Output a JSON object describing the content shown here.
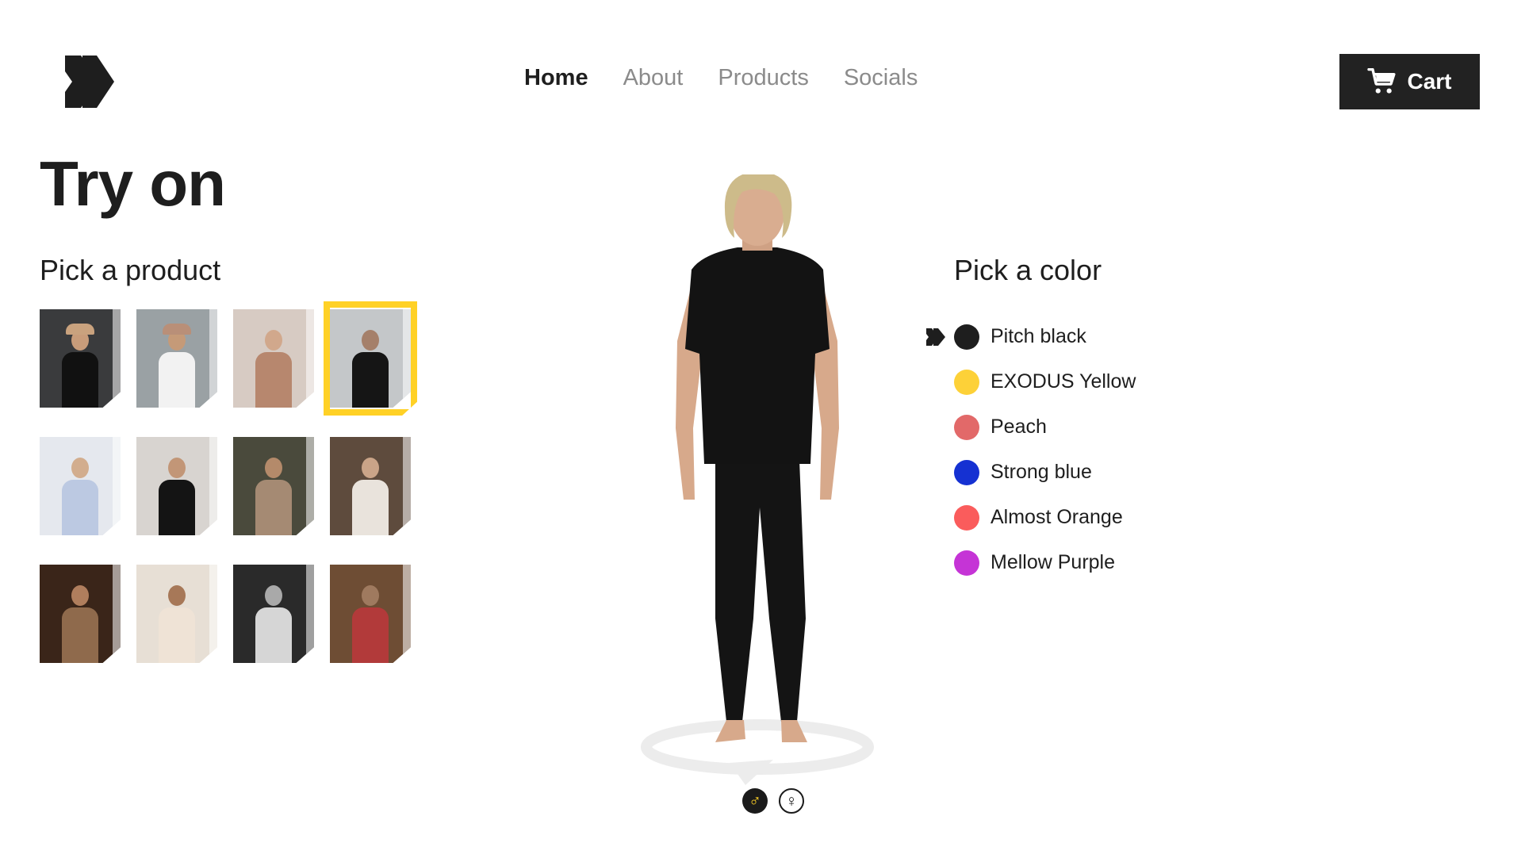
{
  "header": {
    "logo_icon": "double-chevron-logo",
    "nav": [
      {
        "label": "Home",
        "active": true
      },
      {
        "label": "About",
        "active": false
      },
      {
        "label": "Products",
        "active": false
      },
      {
        "label": "Socials",
        "active": false
      }
    ],
    "cart": {
      "label": "Cart",
      "icon": "cart-icon"
    }
  },
  "page": {
    "title": "Try on",
    "pick_product": "Pick a product",
    "pick_color": "Pick a color"
  },
  "products": {
    "selected_index": 3,
    "items": [
      {
        "icon": "product-photo",
        "bg": "#3a3b3d",
        "skin": "#c89c7a",
        "cloth": "#111111",
        "hat": "#c9a27e"
      },
      {
        "icon": "product-photo",
        "bg": "#9aa1a4",
        "skin": "#c59a78",
        "cloth": "#f2f2f2",
        "hat": "#b98f78"
      },
      {
        "icon": "product-photo",
        "bg": "#d7cbc3",
        "skin": "#d1a88c",
        "cloth": "#b7876e",
        "hat": ""
      },
      {
        "icon": "product-photo",
        "bg": "#c4c7c9",
        "skin": "#a5806a",
        "cloth": "#151515",
        "hat": ""
      },
      {
        "icon": "product-photo",
        "bg": "#e5e8ee",
        "skin": "#d2ad8e",
        "cloth": "#bcc9e2",
        "hat": ""
      },
      {
        "icon": "product-photo",
        "bg": "#d8d4d0",
        "skin": "#c29677",
        "cloth": "#141414",
        "hat": ""
      },
      {
        "icon": "product-photo",
        "bg": "#4a4a3c",
        "skin": "#b48a6a",
        "cloth": "#a58a73",
        "hat": ""
      },
      {
        "icon": "product-photo",
        "bg": "#5e4b3d",
        "skin": "#caa488",
        "cloth": "#e9e3dc",
        "hat": ""
      },
      {
        "icon": "product-photo",
        "bg": "#3a2519",
        "skin": "#b07e5d",
        "cloth": "#8f6a4c",
        "hat": ""
      },
      {
        "icon": "product-photo",
        "bg": "#e7dfd5",
        "skin": "#a77858",
        "cloth": "#efe3d6",
        "hat": ""
      },
      {
        "icon": "product-photo",
        "bg": "#2a2a2a",
        "skin": "#a9a9a9",
        "cloth": "#d6d6d6",
        "hat": ""
      },
      {
        "icon": "product-photo",
        "bg": "#6e4d34",
        "skin": "#9f7a5f",
        "cloth": "#b23a3a",
        "hat": ""
      }
    ]
  },
  "avatar": {
    "icon": "3d-avatar",
    "rotate_icon": "rotate-arrow-icon",
    "genders": [
      {
        "icon": "male-icon",
        "symbol": "♂",
        "active": true
      },
      {
        "icon": "female-icon",
        "symbol": "♀",
        "active": false
      }
    ]
  },
  "colors": {
    "selected_index": 0,
    "items": [
      {
        "name": "Pitch black",
        "hex": "#1e1e1e"
      },
      {
        "name": "EXODUS Yellow",
        "hex": "#fdd138"
      },
      {
        "name": "Peach",
        "hex": "#e26969"
      },
      {
        "name": "Strong blue",
        "hex": "#1531d2"
      },
      {
        "name": "Almost Orange",
        "hex": "#fa5c5c"
      },
      {
        "name": "Mellow Purple",
        "hex": "#c534d6"
      }
    ]
  }
}
